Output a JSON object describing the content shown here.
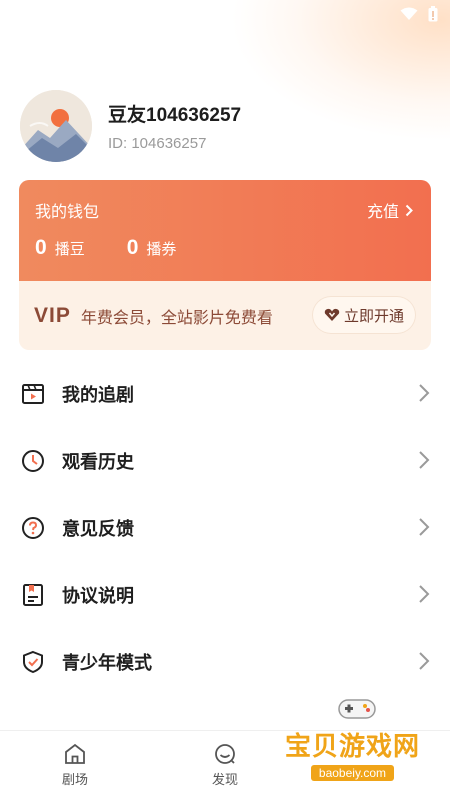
{
  "status_bar": {
    "wifi_icon": "wifi-icon",
    "battery_icon": "battery-icon"
  },
  "profile": {
    "nickname": "豆友104636257",
    "user_id": "ID: 104636257"
  },
  "wallet": {
    "title": "我的钱包",
    "recharge_label": "充值",
    "beans_value": "0",
    "beans_label": "播豆",
    "coupons_value": "0",
    "coupons_label": "播券"
  },
  "vip": {
    "badge": "VIP",
    "description": "年费会员，全站影片免费看",
    "button_label": "立即开通"
  },
  "menu": [
    {
      "label": "我的追剧",
      "icon": "clapperboard-icon"
    },
    {
      "label": "观看历史",
      "icon": "clock-icon"
    },
    {
      "label": "意见反馈",
      "icon": "question-icon"
    },
    {
      "label": "协议说明",
      "icon": "document-icon"
    },
    {
      "label": "青少年模式",
      "icon": "shield-check-icon"
    }
  ],
  "bottom_nav": [
    {
      "label": "剧场",
      "icon": "home-icon"
    },
    {
      "label": "发现",
      "icon": "discover-icon"
    }
  ],
  "watermark": {
    "title": "宝贝游戏网",
    "url": "baobeiy.com"
  },
  "colors": {
    "wallet_gradient_start": "#f08a5e",
    "wallet_gradient_end": "#f26f4f",
    "vip_text": "#8c4a37",
    "watermark": "#f0a418"
  }
}
